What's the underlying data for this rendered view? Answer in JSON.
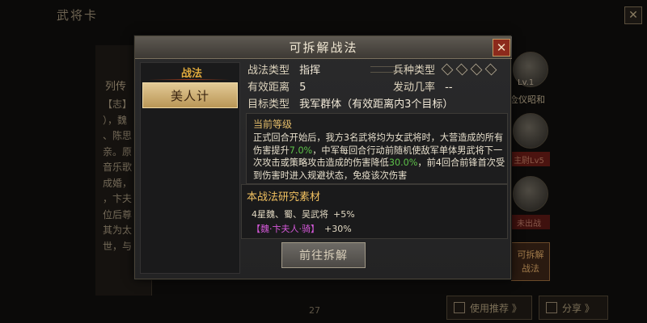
{
  "background": {
    "title": "武将卡",
    "close_icon": "close-icon",
    "bio_title": "列传",
    "bio_lines": "【志】\n），魏\n、陈思\n亲。原\n音乐歌\n成婚，\n，卞夫\n位后尊\n其为太\n世，与",
    "page_number": "27",
    "level_label": "Lv.1",
    "general_name": "佥仪昭和",
    "level_tag": "主尉Lv5",
    "tag2": "未出战",
    "decompose_button": "可拆解\n战法",
    "recommend_button": "使用推荐 》",
    "share_button": "分享 》"
  },
  "modal": {
    "title": "可拆解战法",
    "close_icon": "close-icon",
    "tab_header": "战法",
    "tabs": [
      {
        "label": "美人计",
        "selected": true
      }
    ],
    "info": {
      "type_label": "战法类型",
      "type_value": "指挥",
      "troop_label": "兵种类型",
      "range_label": "有效距离",
      "range_value": "5",
      "rate_label": "发动几率",
      "rate_value": "--",
      "target_label": "目标类型",
      "target_value": "我军群体（有效距离内3个目标）"
    },
    "effect": {
      "level_label": "当前等级",
      "text_part1": "正式回合开始后，我方3名武将均为女武将时，大营造成的所有伤害提升",
      "pct1": "7.0%",
      "text_part2": "，中军每回合行动前随机使敌军单体男武将下一次攻击或策略攻击造成的伤害降低",
      "pct2": "30.0%",
      "text_part3": "，前4回合前锋首次受到伤害时进入规避状态，免疫该次伤害"
    },
    "material": {
      "title": "本战法研究素材",
      "line1_text": "4星魏、蜀、吴武将",
      "line1_bonus": "+5%",
      "line2_text": "【魏·卞夫人·骑】",
      "line2_bonus": "+30%"
    },
    "go_button": "前往拆解"
  },
  "colors": {
    "accent_gold": "#e0aa3c",
    "highlight_green": "#5ec24a",
    "highlight_purple": "#d458d8",
    "close_red": "#8c2a1c"
  }
}
